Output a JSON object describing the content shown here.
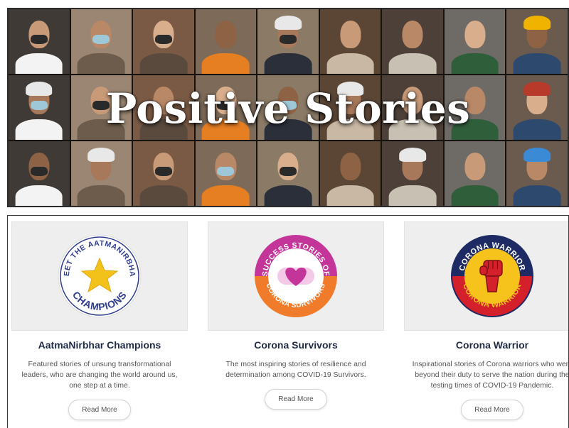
{
  "banner": {
    "title": "Positive Stories"
  },
  "cards": [
    {
      "logo_text_top": "MEET THE AATMANIRBHAR",
      "logo_text_bottom": "CHAMPIONS",
      "title": "AatmaNirbhar Champions",
      "description": "Featured stories of unsung transformational leaders, who are changing the world around us, one step at a time.",
      "button": "Read More"
    },
    {
      "logo_text_top": "SUCCESS STORIES OF",
      "logo_text_bottom": "CORONA SURVIVORS",
      "title": "Corona Survivors",
      "description": "The most inspiring stories of resilience and determination among COVID-19 Survivors.",
      "button": "Read More"
    },
    {
      "logo_text_top": "CORONA WARRIOR",
      "logo_text_bottom": "CORONA WARRIOR",
      "title": "Corona Warrior",
      "description": "Inspirational stories of Corona warriors who went beyond their duty to serve the nation during the testing times of COVID-19 Pandemic.",
      "button": "Read More"
    }
  ],
  "colors": {
    "title_navy": "#1f2a44",
    "champion_blue": "#2f3d8f",
    "champion_gold": "#f2c21b",
    "survivor_pink": "#c4359a",
    "survivor_orange": "#f07b2a",
    "warrior_navy": "#1d2a63",
    "warrior_red": "#d3202a",
    "warrior_yellow": "#f6c21c"
  }
}
